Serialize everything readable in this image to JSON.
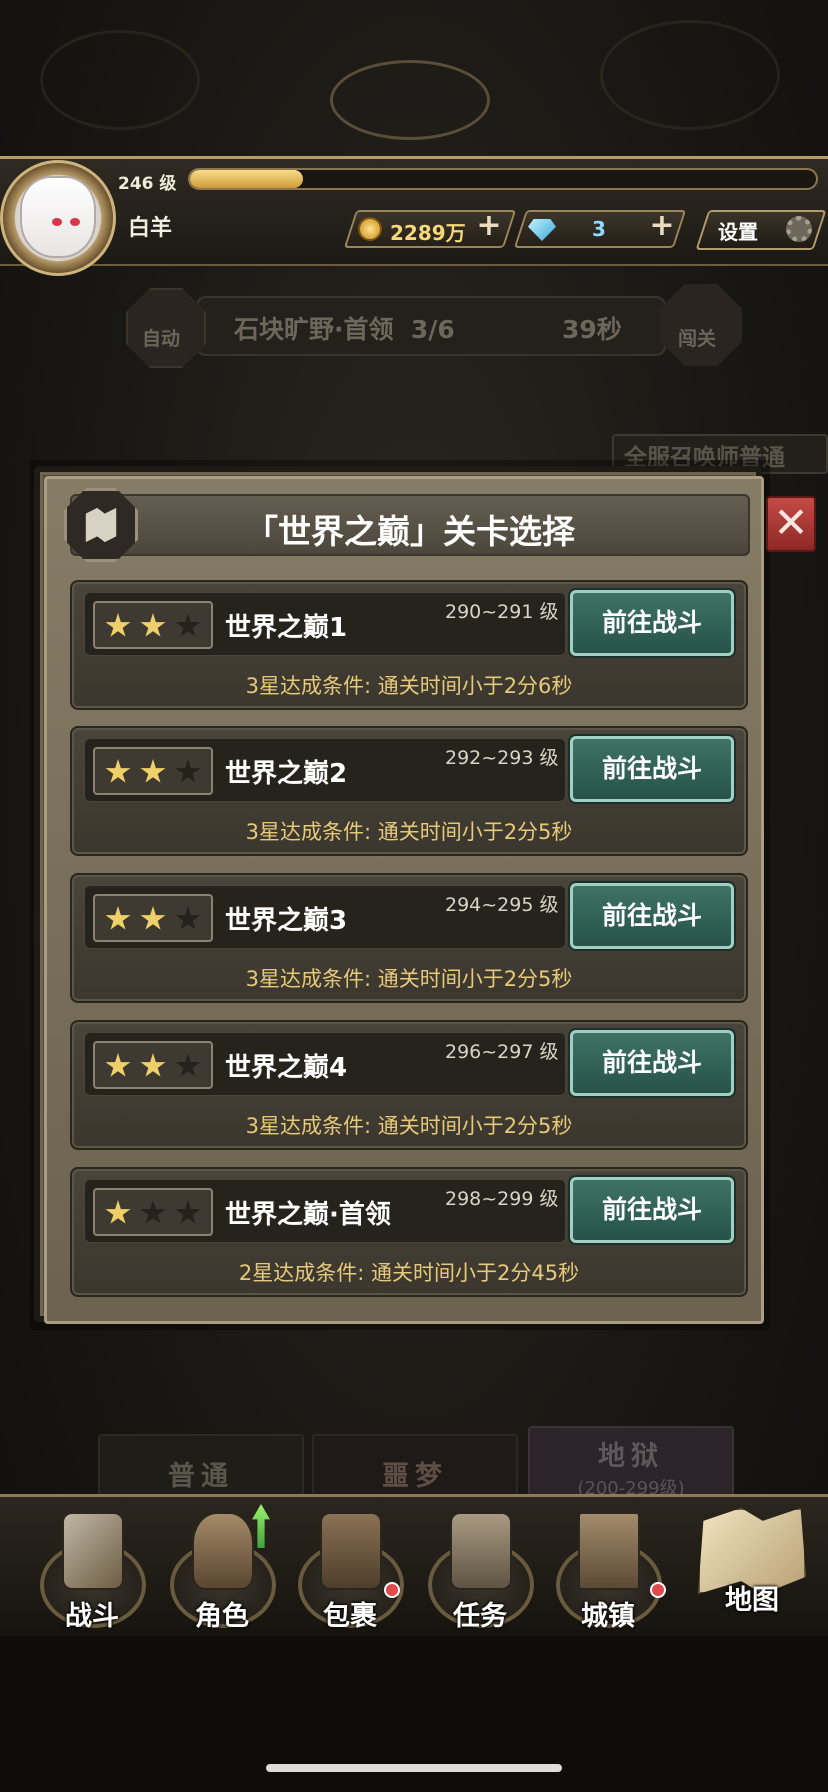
{
  "player": {
    "level": "246 级",
    "name": "白羊",
    "xp_fraction": 0.18
  },
  "resources": {
    "gold": "2289万",
    "diamonds": "3",
    "plus": "+",
    "settings_label": "设置"
  },
  "stage_bar": {
    "auto_label": "自动",
    "stage_name": "石块旷野·首领  3/6",
    "timer": "39秒",
    "challenge_label": "闯关"
  },
  "announcement": "全服召唤师普通",
  "modal": {
    "title": "「世界之巅」关卡选择",
    "close": "✕",
    "levels": [
      {
        "name": "世界之巅1",
        "range": "290~291 级",
        "stars": 2,
        "button": "前往战斗",
        "condition": "3星达成条件:  通关时间小于2分6秒"
      },
      {
        "name": "世界之巅2",
        "range": "292~293 级",
        "stars": 2,
        "button": "前往战斗",
        "condition": "3星达成条件:  通关时间小于2分5秒"
      },
      {
        "name": "世界之巅3",
        "range": "294~295 级",
        "stars": 2,
        "button": "前往战斗",
        "condition": "3星达成条件:  通关时间小于2分5秒"
      },
      {
        "name": "世界之巅4",
        "range": "296~297 级",
        "stars": 2,
        "button": "前往战斗",
        "condition": "3星达成条件:  通关时间小于2分5秒"
      },
      {
        "name": "世界之巅·首领",
        "range": "298~299 级",
        "stars": 1,
        "button": "前往战斗",
        "condition": "2星达成条件:  通关时间小于2分45秒"
      }
    ]
  },
  "difficulty": {
    "normal": "普通",
    "nightmare": "噩梦",
    "hell": "地狱",
    "hell_range": "(200-299级)"
  },
  "nav": {
    "battle": "战斗",
    "character": "角色",
    "bag": "包裹",
    "quests": "任务",
    "town": "城镇",
    "map": "地图"
  },
  "colors": {
    "accent_gold": "#efcf6a",
    "button_green": "#3e7364",
    "close_red": "#c44b46"
  }
}
